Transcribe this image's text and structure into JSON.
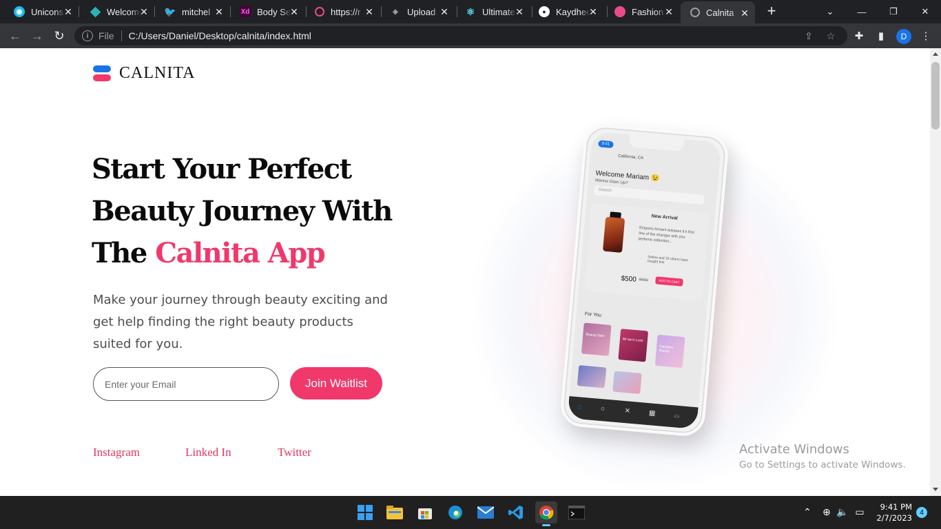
{
  "browser": {
    "tabs": [
      {
        "title": "Unicons",
        "icon": "unicons-icon",
        "color": "#1ebbee"
      },
      {
        "title": "Welcome",
        "icon": "diamond-icon",
        "color": "#27b3b9"
      },
      {
        "title": "mitchel",
        "icon": "twitter-icon",
        "color": "#1d9bf0"
      },
      {
        "title": "Body Se",
        "icon": "adobe-xd-icon",
        "color": "#470137"
      },
      {
        "title": "https://r",
        "icon": "dribbble-like-icon",
        "color": "#ea4c89"
      },
      {
        "title": "Upload",
        "icon": "stack-icon",
        "color": "#9aa0a6"
      },
      {
        "title": "Ultimate",
        "icon": "react-icon",
        "color": "#61dafb"
      },
      {
        "title": "Kaydhee",
        "icon": "github-icon",
        "color": "#ffffff"
      },
      {
        "title": "Fashion",
        "icon": "dribbble-icon",
        "color": "#ea4c89"
      },
      {
        "title": "Calnita",
        "icon": "globe-icon",
        "color": "#9aa0a6"
      }
    ],
    "active_tab_index": 9,
    "url_scheme": "File",
    "url": "C:/Users/Daniel/Desktop/calnita/index.html",
    "profile_initial": "D"
  },
  "page": {
    "logo_text": "CALNITA",
    "headline_line1": "Start Your Perfect",
    "headline_line2": "Beauty Journey With",
    "headline_prefix": "The ",
    "headline_accent": "Calnita App",
    "subtitle": "Make your journey through beauty exciting and get help finding the right beauty products suited for you.",
    "email_placeholder": "Enter your Email",
    "cta_label": "Join Waitlist",
    "social_links": [
      "Instagram",
      "Linked In",
      "Twitter"
    ],
    "accent_color": "#f0386b"
  },
  "phone": {
    "status_time": "9:41",
    "location": "California, CA",
    "welcome": "Welcome Mariam 😉",
    "welcome_sub": "Wanna Glam Up?",
    "search_placeholder": "Search",
    "new_arrival": "New Arrival",
    "product_desc": "Emporio Armani releases it's first line of the stranger with you perfume collection...",
    "online_text": "Online and 32 others have bought this",
    "price": "$500",
    "old_price": "$650",
    "add_to_cart": "ADD TO CART",
    "for_you": "For You",
    "thumb_labels": [
      "Beauty Sets",
      "Mr Ian's Look",
      "Fabulous Brands"
    ]
  },
  "watermark": {
    "line1": "Activate Windows",
    "line2": "Go to Settings to activate Windows."
  },
  "taskbar": {
    "time": "9:41 PM",
    "date": "2/7/2023",
    "notification_count": "4"
  }
}
